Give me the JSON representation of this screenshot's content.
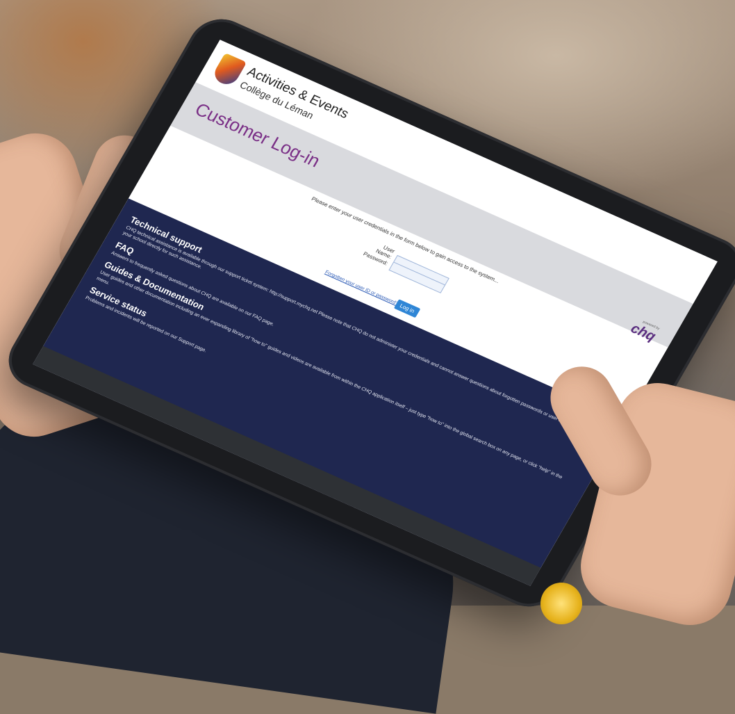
{
  "brand": {
    "title": "Activities & Events",
    "subtitle": "Collège du Léman"
  },
  "page_title": "Customer Log-in",
  "login": {
    "intro": "Please enter your user credentials in the form below to gain access to the system...",
    "username_label": "User Name:",
    "password_label": "Password:",
    "forgot_link": "Forgotten your user ID or password?",
    "login_button": "Log in"
  },
  "powered": {
    "label": "powered by",
    "logo": "chq"
  },
  "footer": {
    "sections": [
      {
        "heading": "Technical support",
        "text": "CHQ technical assistance is available through our support ticket system: http://support.mychq.net Please note that CHQ do not administer your credentials and cannot answer questions about forgotten passwords or user IDs – please contact your school directly for such assistance."
      },
      {
        "heading": "FAQ",
        "text": "Answers to frequently asked questions about CHQ are available on our FAQ page."
      },
      {
        "heading": "Guides & Documentation",
        "text": "User guides and other documentation including an ever expanding library of \"how to\" guides and videos are available from within the CHQ application itself – just type \"how to\" into the global search box on any page, or click \"help\" in the menu."
      },
      {
        "heading": "Service status",
        "text": "Problems and incidents will be reported on our Support page."
      }
    ]
  },
  "colors": {
    "title_purple": "#7a2f86",
    "footer_navy": "#1f2750",
    "button_blue": "#2f86d6"
  }
}
